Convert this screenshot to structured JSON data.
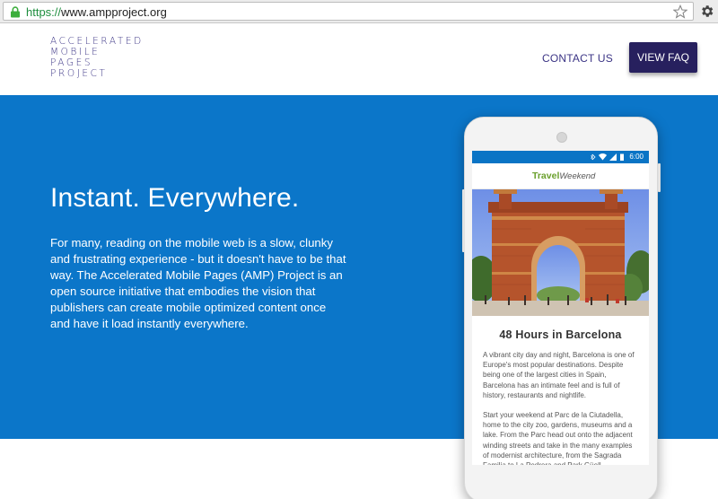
{
  "browser": {
    "url_scheme": "https://",
    "url_host": "www.ampproject.org"
  },
  "header": {
    "logo_lines": [
      "ACCELERATED",
      "MOBILE",
      "PAGES",
      "PROJECT"
    ],
    "contact_label": "CONTACT US",
    "faq_label": "VIEW FAQ"
  },
  "hero": {
    "title": "Instant. Everywhere.",
    "text": "For many, reading on the mobile web is a slow, clunky and frustrating experience - but it doesn't have to be that way. The Accelerated Mobile Pages (AMP) Project is an open source initiative that embodies the vision that publishers can create mobile optimized content once and have it load instantly everywhere."
  },
  "phone": {
    "status_time": "6:00",
    "brand_part1": "Travel",
    "brand_part2": "Weekend",
    "article_title": "48 Hours in Barcelona",
    "paragraphs": [
      "A vibrant city day and night, Barcelona is one of Europe's most popular destinations. Despite being one of the largest cities in Spain, Barcelona has an intimate feel and is full of history, restaurants and nightlife.",
      "Start your weekend at Parc de la Ciutadella, home to the city zoo, gardens, museums and a lake. From the Parc head out onto the adjacent winding streets and take in the many examples of modernist architecture, from the Sagrada Familia to La Pedrera and Park Güell."
    ]
  },
  "colors": {
    "hero_blue": "#0b76c9",
    "brand_purple": "#3b3485",
    "button_navy": "#27205e",
    "https_green": "#1e8e3e"
  },
  "icons": {
    "lock": "lock-icon",
    "star": "star-icon",
    "settings": "gear-icon"
  }
}
